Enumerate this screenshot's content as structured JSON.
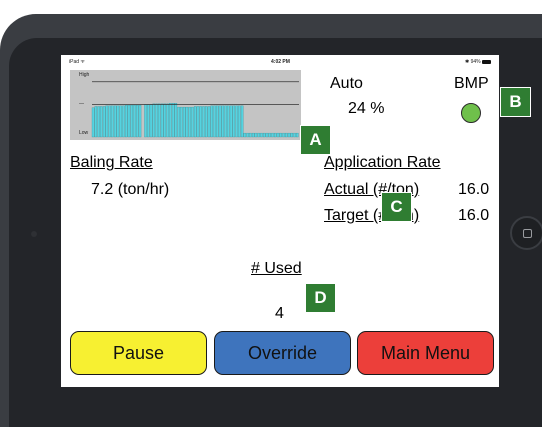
{
  "status_bar": {
    "device": "iPad ᯤ",
    "time": "4:02 PM",
    "battery": "✱ 94%"
  },
  "chart_data": {
    "type": "bar",
    "y_labels": [
      "High",
      "—",
      "Low"
    ],
    "ylim": [
      0,
      100
    ],
    "reference_lines": [
      85,
      50
    ],
    "values": [
      45,
      47,
      47,
      47,
      47,
      48,
      48,
      48,
      48,
      48,
      48,
      48,
      49,
      49,
      49,
      49,
      49,
      49,
      0,
      50,
      50,
      50,
      51,
      51,
      51,
      51,
      51,
      51,
      52,
      52,
      52,
      46,
      46,
      46,
      46,
      46,
      46,
      47,
      47,
      47,
      47,
      47,
      47,
      48,
      48,
      48,
      48,
      48,
      48,
      48,
      48,
      48,
      48,
      48,
      48,
      6,
      6,
      6,
      6,
      6,
      6,
      6,
      6,
      6,
      6,
      6,
      6,
      6,
      6,
      6,
      6,
      6,
      6,
      6,
      6
    ],
    "colors": {
      "bar": "#56d3e0",
      "background": "#c4c4c4",
      "line": "#333333"
    }
  },
  "mode": {
    "label": "Auto",
    "percent": "24 %"
  },
  "bmp": {
    "label": "BMP",
    "led_color": "#6fc04b"
  },
  "baling_rate": {
    "title": "Baling Rate",
    "value": "7.2 (ton/hr)"
  },
  "application_rate": {
    "title": "Application Rate",
    "actual_label": "Actual (#/ton)",
    "actual_value": "16.0",
    "target_label": "Target (#/ton)",
    "target_value": "16.0"
  },
  "used": {
    "title": "# Used",
    "value": "4"
  },
  "buttons": {
    "pause": "Pause",
    "override": "Override",
    "main_menu": "Main Menu"
  },
  "callouts": {
    "a": "A",
    "b": "B",
    "c": "C",
    "d": "D"
  }
}
